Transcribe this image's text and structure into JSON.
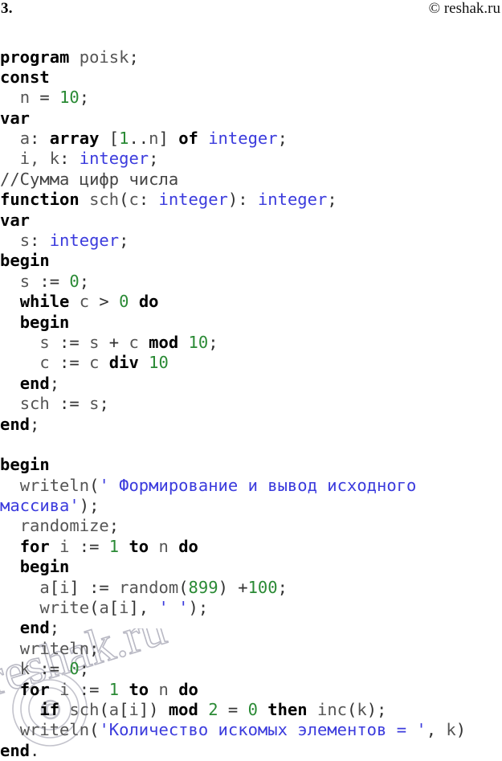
{
  "header": {
    "task_number": "3.",
    "site_credit": "© reshak.ru"
  },
  "watermark": {
    "text": "reshak.ru",
    "symbol": "©"
  },
  "code": {
    "language": "Pascal",
    "lines": [
      {
        "id": "line-01",
        "tokens": [
          {
            "t": "program",
            "c": "kw"
          },
          {
            "t": " ",
            "c": "plain"
          },
          {
            "t": "poisk",
            "c": "id"
          },
          {
            "t": ";",
            "c": "plain"
          }
        ]
      },
      {
        "id": "line-02",
        "tokens": [
          {
            "t": "const",
            "c": "kw"
          }
        ]
      },
      {
        "id": "line-03",
        "tokens": [
          {
            "t": "  ",
            "c": "plain"
          },
          {
            "t": "n",
            "c": "id"
          },
          {
            "t": " = ",
            "c": "plain"
          },
          {
            "t": "10",
            "c": "num"
          },
          {
            "t": ";",
            "c": "plain"
          }
        ]
      },
      {
        "id": "line-04",
        "tokens": [
          {
            "t": "var",
            "c": "kw"
          }
        ]
      },
      {
        "id": "line-05",
        "tokens": [
          {
            "t": "  ",
            "c": "plain"
          },
          {
            "t": "a",
            "c": "id"
          },
          {
            "t": ": ",
            "c": "plain"
          },
          {
            "t": "array",
            "c": "kw"
          },
          {
            "t": " [",
            "c": "plain"
          },
          {
            "t": "1",
            "c": "num"
          },
          {
            "t": "..",
            "c": "plain"
          },
          {
            "t": "n",
            "c": "id"
          },
          {
            "t": "] ",
            "c": "plain"
          },
          {
            "t": "of",
            "c": "kw"
          },
          {
            "t": " ",
            "c": "plain"
          },
          {
            "t": "integer",
            "c": "type"
          },
          {
            "t": ";",
            "c": "plain"
          }
        ]
      },
      {
        "id": "line-06",
        "tokens": [
          {
            "t": "  ",
            "c": "plain"
          },
          {
            "t": "i, k",
            "c": "id"
          },
          {
            "t": ": ",
            "c": "plain"
          },
          {
            "t": "integer",
            "c": "type"
          },
          {
            "t": ";",
            "c": "plain"
          }
        ]
      },
      {
        "id": "line-07",
        "tokens": [
          {
            "t": "//Сумма цифр числа",
            "c": "cmt"
          }
        ]
      },
      {
        "id": "line-08",
        "tokens": [
          {
            "t": "function",
            "c": "kw"
          },
          {
            "t": " ",
            "c": "plain"
          },
          {
            "t": "sch",
            "c": "id"
          },
          {
            "t": "(",
            "c": "plain"
          },
          {
            "t": "c",
            "c": "id"
          },
          {
            "t": ": ",
            "c": "plain"
          },
          {
            "t": "integer",
            "c": "type"
          },
          {
            "t": "): ",
            "c": "plain"
          },
          {
            "t": "integer",
            "c": "type"
          },
          {
            "t": ";",
            "c": "plain"
          }
        ]
      },
      {
        "id": "line-09",
        "tokens": [
          {
            "t": "var",
            "c": "kw"
          }
        ]
      },
      {
        "id": "line-10",
        "tokens": [
          {
            "t": "  ",
            "c": "plain"
          },
          {
            "t": "s",
            "c": "id"
          },
          {
            "t": ": ",
            "c": "plain"
          },
          {
            "t": "integer",
            "c": "type"
          },
          {
            "t": ";",
            "c": "plain"
          }
        ]
      },
      {
        "id": "line-11",
        "tokens": [
          {
            "t": "begin",
            "c": "kw"
          }
        ]
      },
      {
        "id": "line-12",
        "tokens": [
          {
            "t": "  ",
            "c": "plain"
          },
          {
            "t": "s",
            "c": "id"
          },
          {
            "t": " := ",
            "c": "plain"
          },
          {
            "t": "0",
            "c": "num"
          },
          {
            "t": ";",
            "c": "plain"
          }
        ]
      },
      {
        "id": "line-13",
        "tokens": [
          {
            "t": "  ",
            "c": "plain"
          },
          {
            "t": "while",
            "c": "kw"
          },
          {
            "t": " ",
            "c": "plain"
          },
          {
            "t": "c",
            "c": "id"
          },
          {
            "t": " > ",
            "c": "plain"
          },
          {
            "t": "0",
            "c": "num"
          },
          {
            "t": " ",
            "c": "plain"
          },
          {
            "t": "do",
            "c": "kw"
          }
        ]
      },
      {
        "id": "line-14",
        "tokens": [
          {
            "t": "  ",
            "c": "plain"
          },
          {
            "t": "begin",
            "c": "kw"
          }
        ]
      },
      {
        "id": "line-15",
        "tokens": [
          {
            "t": "    ",
            "c": "plain"
          },
          {
            "t": "s",
            "c": "id"
          },
          {
            "t": " := ",
            "c": "plain"
          },
          {
            "t": "s",
            "c": "id"
          },
          {
            "t": " + ",
            "c": "plain"
          },
          {
            "t": "c",
            "c": "id"
          },
          {
            "t": " ",
            "c": "plain"
          },
          {
            "t": "mod",
            "c": "kw"
          },
          {
            "t": " ",
            "c": "plain"
          },
          {
            "t": "10",
            "c": "num"
          },
          {
            "t": ";",
            "c": "plain"
          }
        ]
      },
      {
        "id": "line-16",
        "tokens": [
          {
            "t": "    ",
            "c": "plain"
          },
          {
            "t": "c",
            "c": "id"
          },
          {
            "t": " := ",
            "c": "plain"
          },
          {
            "t": "c",
            "c": "id"
          },
          {
            "t": " ",
            "c": "plain"
          },
          {
            "t": "div",
            "c": "kw"
          },
          {
            "t": " ",
            "c": "plain"
          },
          {
            "t": "10",
            "c": "num"
          }
        ]
      },
      {
        "id": "line-17",
        "tokens": [
          {
            "t": "  ",
            "c": "plain"
          },
          {
            "t": "end",
            "c": "kw"
          },
          {
            "t": ";",
            "c": "plain"
          }
        ]
      },
      {
        "id": "line-18",
        "tokens": [
          {
            "t": "  ",
            "c": "plain"
          },
          {
            "t": "sch",
            "c": "id"
          },
          {
            "t": " := ",
            "c": "plain"
          },
          {
            "t": "s",
            "c": "id"
          },
          {
            "t": ";",
            "c": "plain"
          }
        ]
      },
      {
        "id": "line-19",
        "tokens": [
          {
            "t": "end",
            "c": "kw"
          },
          {
            "t": ";",
            "c": "plain"
          }
        ]
      },
      {
        "id": "line-20",
        "tokens": []
      },
      {
        "id": "line-21",
        "tokens": [
          {
            "t": "begin",
            "c": "kw"
          }
        ]
      },
      {
        "id": "line-22",
        "tokens": [
          {
            "t": "  ",
            "c": "plain"
          },
          {
            "t": "writeln",
            "c": "id"
          },
          {
            "t": "(",
            "c": "plain"
          },
          {
            "t": "' Формирование и вывод исходного",
            "c": "str"
          }
        ]
      },
      {
        "id": "line-23",
        "tokens": [
          {
            "t": "массива'",
            "c": "str"
          },
          {
            "t": ");",
            "c": "plain"
          }
        ]
      },
      {
        "id": "line-24",
        "tokens": [
          {
            "t": "  ",
            "c": "plain"
          },
          {
            "t": "randomize",
            "c": "id"
          },
          {
            "t": ";",
            "c": "plain"
          }
        ]
      },
      {
        "id": "line-25",
        "tokens": [
          {
            "t": "  ",
            "c": "plain"
          },
          {
            "t": "for",
            "c": "kw"
          },
          {
            "t": " ",
            "c": "plain"
          },
          {
            "t": "i",
            "c": "id"
          },
          {
            "t": " := ",
            "c": "plain"
          },
          {
            "t": "1",
            "c": "num"
          },
          {
            "t": " ",
            "c": "plain"
          },
          {
            "t": "to",
            "c": "kw"
          },
          {
            "t": " ",
            "c": "plain"
          },
          {
            "t": "n",
            "c": "id"
          },
          {
            "t": " ",
            "c": "plain"
          },
          {
            "t": "do",
            "c": "kw"
          }
        ]
      },
      {
        "id": "line-26",
        "tokens": [
          {
            "t": "  ",
            "c": "plain"
          },
          {
            "t": "begin",
            "c": "kw"
          }
        ]
      },
      {
        "id": "line-27",
        "tokens": [
          {
            "t": "    ",
            "c": "plain"
          },
          {
            "t": "a",
            "c": "id"
          },
          {
            "t": "[",
            "c": "plain"
          },
          {
            "t": "i",
            "c": "id"
          },
          {
            "t": "] := ",
            "c": "plain"
          },
          {
            "t": "random",
            "c": "id"
          },
          {
            "t": "(",
            "c": "plain"
          },
          {
            "t": "899",
            "c": "num"
          },
          {
            "t": ") +",
            "c": "plain"
          },
          {
            "t": "100",
            "c": "num"
          },
          {
            "t": ";",
            "c": "plain"
          }
        ]
      },
      {
        "id": "line-28",
        "tokens": [
          {
            "t": "    ",
            "c": "plain"
          },
          {
            "t": "write",
            "c": "id"
          },
          {
            "t": "(",
            "c": "plain"
          },
          {
            "t": "a",
            "c": "id"
          },
          {
            "t": "[",
            "c": "plain"
          },
          {
            "t": "i",
            "c": "id"
          },
          {
            "t": "], ",
            "c": "plain"
          },
          {
            "t": "' '",
            "c": "str"
          },
          {
            "t": ");",
            "c": "plain"
          }
        ]
      },
      {
        "id": "line-29",
        "tokens": [
          {
            "t": "  ",
            "c": "plain"
          },
          {
            "t": "end",
            "c": "kw"
          },
          {
            "t": ";",
            "c": "plain"
          }
        ]
      },
      {
        "id": "line-30",
        "tokens": [
          {
            "t": "  ",
            "c": "plain"
          },
          {
            "t": "writeln",
            "c": "id"
          },
          {
            "t": ";",
            "c": "plain"
          }
        ]
      },
      {
        "id": "line-31",
        "tokens": [
          {
            "t": "  ",
            "c": "plain"
          },
          {
            "t": "k",
            "c": "id"
          },
          {
            "t": " := ",
            "c": "plain"
          },
          {
            "t": "0",
            "c": "num"
          },
          {
            "t": ";",
            "c": "plain"
          }
        ]
      },
      {
        "id": "line-32",
        "tokens": [
          {
            "t": "  ",
            "c": "plain"
          },
          {
            "t": "for",
            "c": "kw"
          },
          {
            "t": " ",
            "c": "plain"
          },
          {
            "t": "i",
            "c": "id"
          },
          {
            "t": " := ",
            "c": "plain"
          },
          {
            "t": "1",
            "c": "num"
          },
          {
            "t": " ",
            "c": "plain"
          },
          {
            "t": "to",
            "c": "kw"
          },
          {
            "t": " ",
            "c": "plain"
          },
          {
            "t": "n",
            "c": "id"
          },
          {
            "t": " ",
            "c": "plain"
          },
          {
            "t": "do",
            "c": "kw"
          }
        ]
      },
      {
        "id": "line-33",
        "tokens": [
          {
            "t": "    ",
            "c": "plain"
          },
          {
            "t": "if",
            "c": "kw"
          },
          {
            "t": " ",
            "c": "plain"
          },
          {
            "t": "sch",
            "c": "id"
          },
          {
            "t": "(",
            "c": "plain"
          },
          {
            "t": "a",
            "c": "id"
          },
          {
            "t": "[",
            "c": "plain"
          },
          {
            "t": "i",
            "c": "id"
          },
          {
            "t": "]) ",
            "c": "plain"
          },
          {
            "t": "mod",
            "c": "kw"
          },
          {
            "t": " ",
            "c": "plain"
          },
          {
            "t": "2",
            "c": "num"
          },
          {
            "t": " = ",
            "c": "plain"
          },
          {
            "t": "0",
            "c": "num"
          },
          {
            "t": " ",
            "c": "plain"
          },
          {
            "t": "then",
            "c": "kw"
          },
          {
            "t": " ",
            "c": "plain"
          },
          {
            "t": "inc",
            "c": "id"
          },
          {
            "t": "(",
            "c": "plain"
          },
          {
            "t": "k",
            "c": "id"
          },
          {
            "t": ");",
            "c": "plain"
          }
        ]
      },
      {
        "id": "line-34",
        "tokens": [
          {
            "t": "  ",
            "c": "plain"
          },
          {
            "t": "writeln",
            "c": "id"
          },
          {
            "t": "(",
            "c": "plain"
          },
          {
            "t": "'Количество искомых элементов = '",
            "c": "str"
          },
          {
            "t": ", ",
            "c": "plain"
          },
          {
            "t": "k",
            "c": "id"
          },
          {
            "t": ")",
            "c": "plain"
          }
        ]
      },
      {
        "id": "line-35",
        "tokens": [
          {
            "t": "end",
            "c": "kw"
          },
          {
            "t": ".",
            "c": "plain"
          }
        ]
      }
    ]
  },
  "colors": {
    "keyword": "#000000",
    "identifier": "#555555",
    "number": "#2a8a35",
    "type": "#3b3bdd",
    "string": "#3b3bdd",
    "comment": "#444444",
    "background": "#ffffff",
    "watermark": "#b9b9c4"
  }
}
